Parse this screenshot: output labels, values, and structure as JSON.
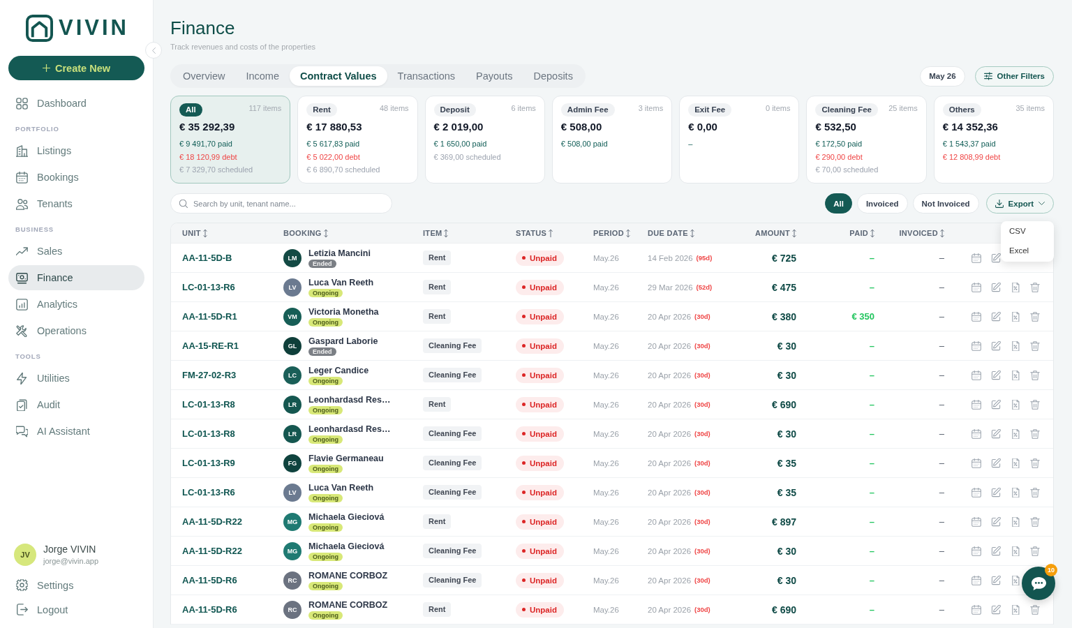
{
  "sidebar": {
    "logo": {
      "text": "VIVIN"
    },
    "create_button": {
      "label": "Create New"
    },
    "nav": [
      {
        "items": [
          {
            "label": "Dashboard",
            "selected": false
          }
        ]
      },
      {
        "title": "PORTFOLIO",
        "items": [
          {
            "label": "Listings",
            "selected": false
          },
          {
            "label": "Bookings",
            "selected": false
          },
          {
            "label": "Tenants",
            "selected": false
          }
        ]
      },
      {
        "title": "BUSINESS",
        "items": [
          {
            "label": "Sales",
            "selected": false
          },
          {
            "label": "Finance",
            "selected": true
          },
          {
            "label": "Analytics",
            "selected": false
          },
          {
            "label": "Operations",
            "selected": false
          }
        ]
      },
      {
        "title": "TOOLS",
        "items": [
          {
            "label": "Utilities",
            "selected": false
          },
          {
            "label": "Audit",
            "selected": false
          },
          {
            "label": "AI Assistant",
            "selected": false
          }
        ]
      }
    ],
    "user": {
      "initials": "JV",
      "name": "Jorge VIVIN",
      "email": "jorge@vivin.app"
    },
    "footer_links": [
      {
        "label": "Settings"
      },
      {
        "label": "Logout"
      }
    ]
  },
  "page": {
    "title": "Finance",
    "subtitle": "Track revenues and costs of the properties"
  },
  "tabs": [
    {
      "label": "Overview",
      "selected": false
    },
    {
      "label": "Income",
      "selected": false
    },
    {
      "label": "Contract Values",
      "selected": true
    },
    {
      "label": "Transactions",
      "selected": false
    },
    {
      "label": "Payouts",
      "selected": false
    },
    {
      "label": "Deposits",
      "selected": false
    }
  ],
  "period_button": {
    "label": "May 26"
  },
  "filters_button": {
    "label": "Other Filters"
  },
  "summary_cards": [
    {
      "tag": "All",
      "count": "117 items",
      "amount": "€ 35 292,39",
      "selected": true,
      "lines": [
        {
          "kind": "paid",
          "text": "€ 9 491,70 paid"
        },
        {
          "kind": "debt",
          "text": "€ 18 120,99 debt"
        },
        {
          "kind": "scheduled",
          "text": "€ 7 329,70 scheduled"
        }
      ]
    },
    {
      "tag": "Rent",
      "count": "48 items",
      "amount": "€ 17 880,53",
      "selected": false,
      "lines": [
        {
          "kind": "paid",
          "text": "€ 5 617,83 paid"
        },
        {
          "kind": "debt",
          "text": "€ 5 022,00 debt"
        },
        {
          "kind": "scheduled",
          "text": "€ 6 890,70 scheduled"
        }
      ]
    },
    {
      "tag": "Deposit",
      "count": "6 items",
      "amount": "€ 2 019,00",
      "selected": false,
      "lines": [
        {
          "kind": "paid",
          "text": "€ 1 650,00 paid"
        },
        {
          "kind": "scheduled",
          "text": "€ 369,00 scheduled"
        }
      ]
    },
    {
      "tag": "Admin Fee",
      "count": "3 items",
      "amount": "€ 508,00",
      "selected": false,
      "lines": [
        {
          "kind": "paid",
          "text": "€ 508,00 paid"
        }
      ]
    },
    {
      "tag": "Exit Fee",
      "count": "0 items",
      "amount": "€ 0,00",
      "selected": false,
      "lines": [
        {
          "kind": "empty",
          "text": "–"
        }
      ]
    },
    {
      "tag": "Cleaning Fee",
      "count": "25 items",
      "amount": "€ 532,50",
      "selected": false,
      "lines": [
        {
          "kind": "paid",
          "text": "€ 172,50 paid"
        },
        {
          "kind": "debt",
          "text": "€ 290,00 debt"
        },
        {
          "kind": "scheduled",
          "text": "€ 70,00 scheduled"
        }
      ]
    },
    {
      "tag": "Others",
      "count": "35 items",
      "amount": "€ 14 352,36",
      "selected": false,
      "lines": [
        {
          "kind": "paid",
          "text": "€ 1 543,37 paid"
        },
        {
          "kind": "debt",
          "text": "€ 12 808,99 debt"
        }
      ]
    }
  ],
  "search": {
    "placeholder": "Search by unit, tenant name..."
  },
  "invoice_filter": [
    {
      "label": "All",
      "selected": true
    },
    {
      "label": "Invoiced",
      "selected": false
    },
    {
      "label": "Not Invoiced",
      "selected": false
    }
  ],
  "export": {
    "label": "Export",
    "menu": [
      "CSV",
      "Excel"
    ]
  },
  "table": {
    "columns": [
      {
        "label": "UNIT",
        "sorted": false
      },
      {
        "label": "BOOKING",
        "sorted": false
      },
      {
        "label": "ITEM",
        "sorted": false
      },
      {
        "label": "STATUS",
        "sorted": true
      },
      {
        "label": "PERIOD",
        "sorted": false
      },
      {
        "label": "DUE DATE",
        "sorted": false
      },
      {
        "label": "AMOUNT",
        "sorted": false
      },
      {
        "label": "PAID",
        "sorted": false
      },
      {
        "label": "INVOICED",
        "sorted": false
      }
    ],
    "rows": [
      {
        "unit": "AA-11-5D-B",
        "booking": {
          "initials": "LM",
          "color": "#134a44",
          "name": "Letizia Mancini",
          "badge": {
            "kind": "ended",
            "label": "Ended"
          }
        },
        "item": "Rent",
        "status": {
          "kind": "unpaid",
          "label": "Unpaid"
        },
        "period": "May.26",
        "due_date": "14 Feb 2026",
        "overdue": "(95d)",
        "amount": "€ 725",
        "paid": "–",
        "invoiced": "–"
      },
      {
        "unit": "LC-01-13-R6",
        "booking": {
          "initials": "LV",
          "color": "#6b7a90",
          "name": "Luca Van Reeth",
          "badge": {
            "kind": "ongoing",
            "label": "Ongoing"
          }
        },
        "item": "Rent",
        "status": {
          "kind": "unpaid",
          "label": "Unpaid"
        },
        "period": "May.26",
        "due_date": "29 Mar 2026",
        "overdue": "(52d)",
        "amount": "€ 475",
        "paid": "–",
        "invoiced": "–"
      },
      {
        "unit": "AA-11-5D-R1",
        "booking": {
          "initials": "VM",
          "color": "#175e56",
          "name": "Victoria Monetha",
          "badge": {
            "kind": "ongoing",
            "label": "Ongoing"
          }
        },
        "item": "Rent",
        "status": {
          "kind": "unpaid",
          "label": "Unpaid"
        },
        "period": "May.26",
        "due_date": "20 Apr 2026",
        "overdue": "(30d)",
        "amount": "€ 380",
        "paid": "€ 350",
        "invoiced": "–"
      },
      {
        "unit": "AA-15-RE-R1",
        "booking": {
          "initials": "GL",
          "color": "#0f3f3a",
          "name": "Gaspard Laborie",
          "badge": {
            "kind": "ended",
            "label": "Ended"
          }
        },
        "item": "Cleaning Fee",
        "status": {
          "kind": "unpaid",
          "label": "Unpaid"
        },
        "period": "May.26",
        "due_date": "20 Apr 2026",
        "overdue": "(30d)",
        "amount": "€ 30",
        "paid": "–",
        "invoiced": "–"
      },
      {
        "unit": "FM-27-02-R3",
        "booking": {
          "initials": "LC",
          "color": "#1a5f58",
          "name": "Leger Candice",
          "badge": {
            "kind": "ongoing",
            "label": "Ongoing"
          }
        },
        "item": "Cleaning Fee",
        "status": {
          "kind": "unpaid",
          "label": "Unpaid"
        },
        "period": "May.26",
        "due_date": "20 Apr 2026",
        "overdue": "(30d)",
        "amount": "€ 30",
        "paid": "–",
        "invoiced": "–"
      },
      {
        "unit": "LC-01-13-R8",
        "booking": {
          "initials": "LR",
          "color": "#155750",
          "name": "Leonhardasd Res…",
          "badge": {
            "kind": "ongoing",
            "label": "Ongoing"
          }
        },
        "item": "Rent",
        "status": {
          "kind": "unpaid",
          "label": "Unpaid"
        },
        "period": "May.26",
        "due_date": "20 Apr 2026",
        "overdue": "(30d)",
        "amount": "€ 690",
        "paid": "–",
        "invoiced": "–"
      },
      {
        "unit": "LC-01-13-R8",
        "booking": {
          "initials": "LR",
          "color": "#155750",
          "name": "Leonhardasd Res…",
          "badge": {
            "kind": "ongoing",
            "label": "Ongoing"
          }
        },
        "item": "Cleaning Fee",
        "status": {
          "kind": "unpaid",
          "label": "Unpaid"
        },
        "period": "May.26",
        "due_date": "20 Apr 2026",
        "overdue": "(30d)",
        "amount": "€ 30",
        "paid": "–",
        "invoiced": "–"
      },
      {
        "unit": "LC-01-13-R9",
        "booking": {
          "initials": "FG",
          "color": "#0f433e",
          "name": "Flavie Germaneau",
          "badge": {
            "kind": "ongoing",
            "label": "Ongoing"
          }
        },
        "item": "Cleaning Fee",
        "status": {
          "kind": "unpaid",
          "label": "Unpaid"
        },
        "period": "May.26",
        "due_date": "20 Apr 2026",
        "overdue": "(30d)",
        "amount": "€ 35",
        "paid": "–",
        "invoiced": "–"
      },
      {
        "unit": "LC-01-13-R6",
        "booking": {
          "initials": "LV",
          "color": "#6b7a90",
          "name": "Luca Van Reeth",
          "badge": {
            "kind": "ongoing",
            "label": "Ongoing"
          }
        },
        "item": "Cleaning Fee",
        "status": {
          "kind": "unpaid",
          "label": "Unpaid"
        },
        "period": "May.26",
        "due_date": "20 Apr 2026",
        "overdue": "(30d)",
        "amount": "€ 35",
        "paid": "–",
        "invoiced": "–"
      },
      {
        "unit": "AA-11-5D-R22",
        "booking": {
          "initials": "MG",
          "color": "#1f7a72",
          "name": "Michaela Gieciová",
          "badge": {
            "kind": "ongoing",
            "label": "Ongoing"
          }
        },
        "item": "Rent",
        "status": {
          "kind": "unpaid",
          "label": "Unpaid"
        },
        "period": "May.26",
        "due_date": "20 Apr 2026",
        "overdue": "(30d)",
        "amount": "€ 897",
        "paid": "–",
        "invoiced": "–"
      },
      {
        "unit": "AA-11-5D-R22",
        "booking": {
          "initials": "MG",
          "color": "#1f7a72",
          "name": "Michaela Gieciová",
          "badge": {
            "kind": "ongoing",
            "label": "Ongoing"
          }
        },
        "item": "Cleaning Fee",
        "status": {
          "kind": "unpaid",
          "label": "Unpaid"
        },
        "period": "May.26",
        "due_date": "20 Apr 2026",
        "overdue": "(30d)",
        "amount": "€ 30",
        "paid": "–",
        "invoiced": "–"
      },
      {
        "unit": "AA-11-5D-R6",
        "booking": {
          "initials": "RC",
          "color": "#6b7280",
          "name": "ROMANE CORBOZ",
          "badge": {
            "kind": "ongoing",
            "label": "Ongoing"
          }
        },
        "item": "Cleaning Fee",
        "status": {
          "kind": "unpaid",
          "label": "Unpaid"
        },
        "period": "May.26",
        "due_date": "20 Apr 2026",
        "overdue": "(30d)",
        "amount": "€ 30",
        "paid": "–",
        "invoiced": "–"
      },
      {
        "unit": "AA-11-5D-R6",
        "booking": {
          "initials": "RC",
          "color": "#6b7280",
          "name": "ROMANE CORBOZ",
          "badge": {
            "kind": "ongoing",
            "label": "Ongoing"
          }
        },
        "item": "Rent",
        "status": {
          "kind": "unpaid",
          "label": "Unpaid"
        },
        "period": "May.26",
        "due_date": "20 Apr 2026",
        "overdue": "(30d)",
        "amount": "€ 690",
        "paid": "–",
        "invoiced": "–"
      }
    ]
  },
  "chat_widget": {
    "badge": "10"
  }
}
